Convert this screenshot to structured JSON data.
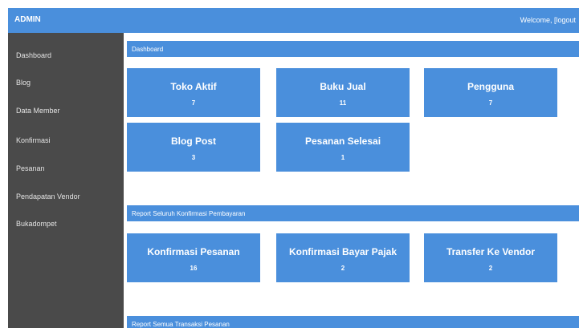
{
  "header": {
    "brand": "ADMIN",
    "welcome_text": "Welcome, ",
    "logout_label": "[logout"
  },
  "sidebar": {
    "items": [
      {
        "label": "Dashboard"
      },
      {
        "label": "Blog"
      },
      {
        "label": "Data Member"
      },
      {
        "label": "Konfirmasi"
      },
      {
        "label": "Pesanan"
      },
      {
        "label": "Pendapatan Vendor"
      },
      {
        "label": "Bukadompet"
      }
    ]
  },
  "sections": [
    {
      "title": "Dashboard",
      "cards": [
        {
          "title": "Toko Aktif",
          "value": "7"
        },
        {
          "title": "Buku Jual",
          "value": "11"
        },
        {
          "title": "Pengguna",
          "value": "7"
        },
        {
          "title": "Blog Post",
          "value": "3"
        },
        {
          "title": "Pesanan Selesai",
          "value": "1"
        }
      ]
    },
    {
      "title": "Report Seluruh Konfirmasi Pembayaran",
      "cards": [
        {
          "title": "Konfirmasi Pesanan",
          "value": "16"
        },
        {
          "title": "Konfirmasi Bayar Pajak",
          "value": "2"
        },
        {
          "title": "Transfer Ke Vendor",
          "value": "2"
        }
      ]
    },
    {
      "title": "Report Semua Transaksi Pesanan",
      "cards": []
    }
  ],
  "colors": {
    "accent": "#4a8fdc",
    "sidebar_bg": "#4a4a4a"
  }
}
